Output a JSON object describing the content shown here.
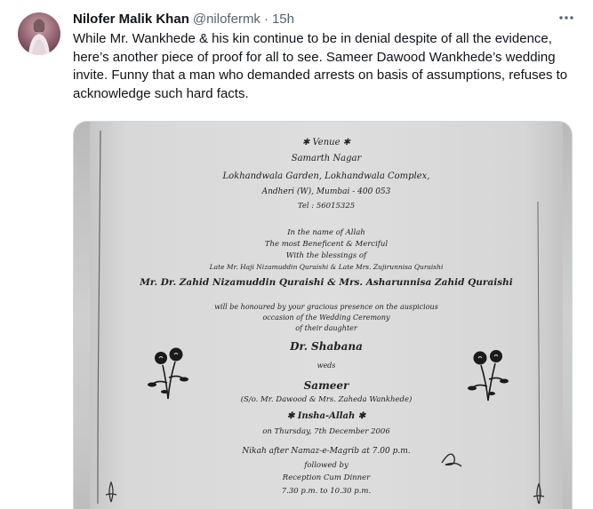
{
  "tweet": {
    "author_name": "Nilofer Malik Khan",
    "handle": "@nilofermk",
    "separator": "·",
    "time": "15h",
    "text": "While Mr. Wankhede & his kin continue to be in denial despite of all the evidence, here’s another piece of proof for all to see. Sameer Dawood Wankhede’s wedding invite. Funny that a man who demanded arrests on basis of assumptions, refuses to acknowledge such hard facts.",
    "more_icon": "more-horizontal-icon"
  },
  "invite": {
    "venue_heading": "✱ Venue ✱",
    "venue_name": "Samarth Nagar",
    "venue_address": "Lokhandwala Garden, Lokhandwala Complex,",
    "venue_city": "Andheri (W), Mumbai - 400 053",
    "venue_tel": "Tel : 56015325",
    "allah_line": "In the name of Allah",
    "beneficent_line": "The most Beneficent & Merciful",
    "blessings_line": "With the blessings of",
    "late_parents": "Late Mr. Haji Nizamuddin Quraishi & Late Mrs. Zujirunnisa Quraishi",
    "hosts": "Mr. Dr. Zahid Nizamuddin Quraishi & Mrs. Asharunnisa Zahid Quraishi",
    "honoured_line": "will be honoured by your gracious presence on the auspicious",
    "occasion_line": "occasion of the Wedding Ceremony",
    "daughter_line": "of their daughter",
    "bride": "Dr. Shabana",
    "weds": "weds",
    "groom": "Sameer",
    "groom_parents": "(S/o. Mr. Dawood & Mrs. Zaheda Wankhede)",
    "insha_allah": "✱ Insha-Allah ✱",
    "date": "on Thursday, 7th December 2006",
    "nikah": "Nikah after Namaz-e-Magrib at 7.00 p.m.",
    "followed_by": "followed by",
    "reception": "Reception Cum Dinner",
    "reception_time": "7.30 p.m. to 10.30 p.m."
  },
  "colors": {
    "text_primary": "#0f1419",
    "text_secondary": "#536471",
    "border": "#cfd9de"
  }
}
